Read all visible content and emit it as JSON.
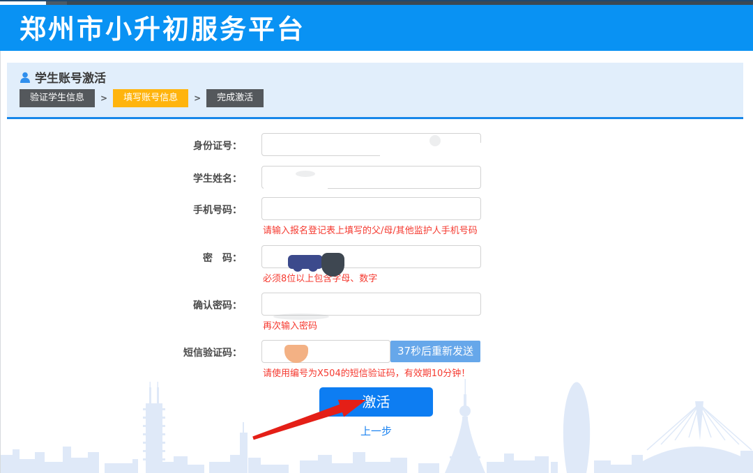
{
  "header": {
    "title": "郑州市小升初服务平台"
  },
  "section": {
    "title": "学生账号激活",
    "step_separator": ">",
    "steps": [
      {
        "label": "验证学生信息",
        "active": false
      },
      {
        "label": "填写账号信息",
        "active": true
      },
      {
        "label": "完成激活",
        "active": false
      }
    ]
  },
  "form": {
    "id_label": "身份证号：",
    "name_label": "学生姓名：",
    "phone_label": "手机号码：",
    "phone_hint": "请输入报名登记表上填写的父/母/其他监护人手机号码",
    "password_label": "密　码：",
    "password_hint": "必须8位以上包含字母、数字",
    "confirm_label": "确认密码：",
    "confirm_hint": "再次输入密码",
    "sms_label": "短信验证码：",
    "sms_hint": "请使用编号为X504的短信验证码，有效期10分钟！",
    "resend_button": "37秒后重新发送",
    "activate_button": "激活",
    "back_link": "上一步"
  },
  "colors": {
    "header_blue": "#0992f3",
    "panel_blue": "#e1eefb",
    "accent_line": "#1687e9",
    "step_active_orange": "#ffb40d",
    "step_inactive_gray": "#54585c",
    "hint_red": "#f5392f",
    "resend_blue": "#66a7ea",
    "activate_blue": "#0d7df2",
    "link_blue": "#1b83f1",
    "arrow_red": "#e41f17",
    "skyline_blue": "#dfe9f8"
  }
}
